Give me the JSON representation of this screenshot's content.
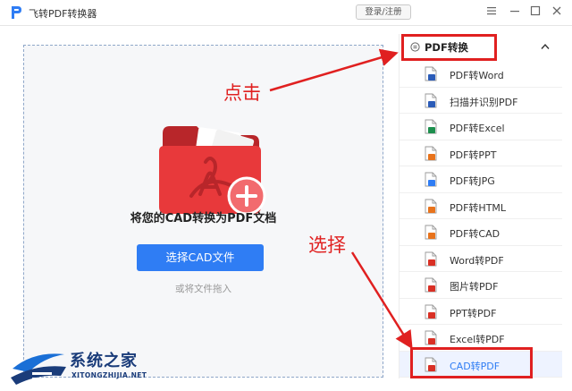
{
  "app": {
    "title": "飞转PDF转换器",
    "login_label": "登录/注册"
  },
  "dropzone": {
    "title": "将您的CAD转换为PDF文档",
    "select_button": "选择CAD文件",
    "drag_hint": "或将文件拖入"
  },
  "sidebar": {
    "group_title": "PDF转换",
    "items": [
      {
        "label": "PDF转Word",
        "icon": "word-file-icon",
        "color": "#2b5cb8"
      },
      {
        "label": "扫描并识别PDF",
        "icon": "word-file-icon",
        "color": "#2b5cb8"
      },
      {
        "label": "PDF转Excel",
        "icon": "excel-file-icon",
        "color": "#1d8f4e"
      },
      {
        "label": "PDF转PPT",
        "icon": "ppt-file-icon",
        "color": "#e8731c"
      },
      {
        "label": "PDF转JPG",
        "icon": "image-file-icon",
        "color": "#2f7df4"
      },
      {
        "label": "PDF转HTML",
        "icon": "html-file-icon",
        "color": "#e8731c"
      },
      {
        "label": "PDF转CAD",
        "icon": "cad-file-icon",
        "color": "#e8731c"
      },
      {
        "label": "Word转PDF",
        "icon": "pdf-file-icon",
        "color": "#d93025"
      },
      {
        "label": "图片转PDF",
        "icon": "pdf-file-icon",
        "color": "#d93025"
      },
      {
        "label": "PPT转PDF",
        "icon": "pdf-file-icon",
        "color": "#d93025"
      },
      {
        "label": "Excel转PDF",
        "icon": "pdf-file-icon",
        "color": "#d93025"
      },
      {
        "label": "CAD转PDF",
        "icon": "pdf-file-icon",
        "color": "#d93025"
      }
    ]
  },
  "annotations": {
    "click_text": "点击",
    "select_text": "选择",
    "color": "#e02020"
  },
  "watermark": {
    "name": "系统之家",
    "url": "XITONGZHIJIA.NET"
  },
  "colors": {
    "accent": "#2f7df4",
    "folder": "#e8393b"
  }
}
